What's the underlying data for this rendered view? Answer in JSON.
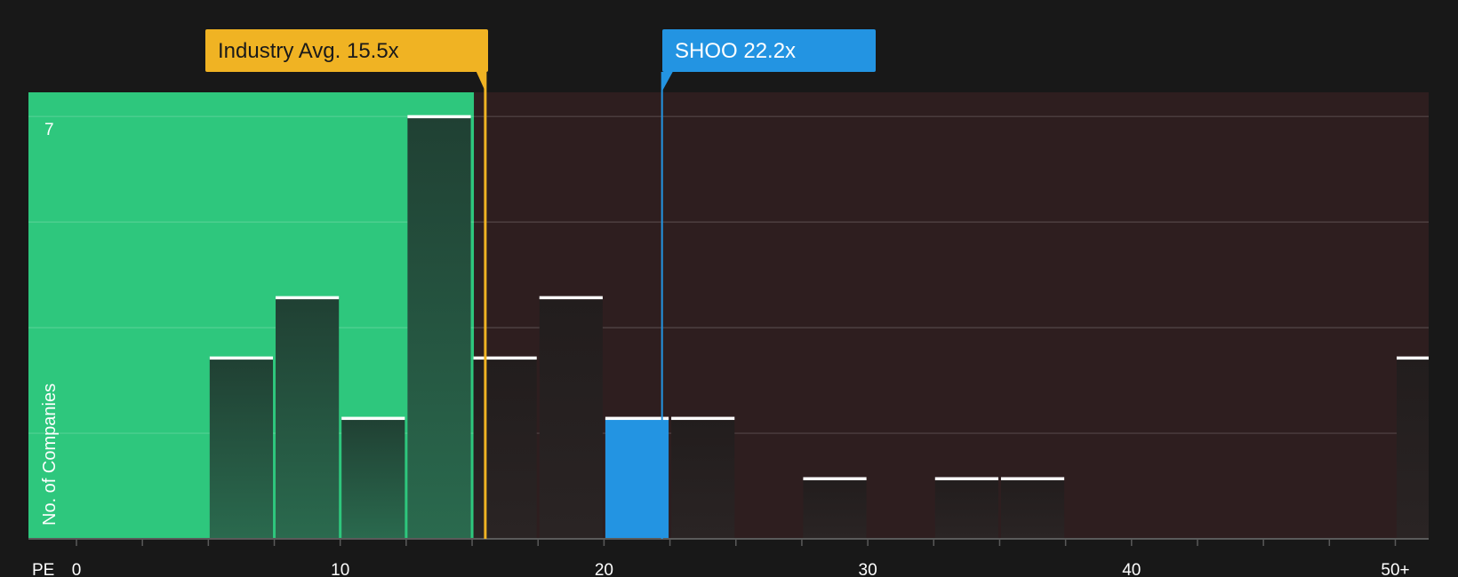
{
  "chart_data": {
    "type": "bar",
    "xlabel": "PE",
    "ylabel": "No. of Companies",
    "xlim": [
      0,
      52.5
    ],
    "ylim": [
      0,
      7.4
    ],
    "x_ticks": [
      0,
      10,
      20,
      30,
      40,
      50
    ],
    "x_tick_labels": [
      "0",
      "10",
      "20",
      "30",
      "40",
      "50+"
    ],
    "y_tick_labels": [
      {
        "value": 7,
        "label": "7"
      }
    ],
    "bin_width": 2.5,
    "bins": [
      {
        "x0": 5,
        "count": 3
      },
      {
        "x0": 7.5,
        "count": 4
      },
      {
        "x0": 10,
        "count": 2
      },
      {
        "x0": 12.5,
        "count": 7
      },
      {
        "x0": 15,
        "count": 3
      },
      {
        "x0": 17.5,
        "count": 4
      },
      {
        "x0": 20,
        "count": 2,
        "highlight": true
      },
      {
        "x0": 22.5,
        "count": 2
      },
      {
        "x0": 27.5,
        "count": 1
      },
      {
        "x0": 32.5,
        "count": 1
      },
      {
        "x0": 35,
        "count": 1
      },
      {
        "x0": 50,
        "count": 3
      }
    ],
    "markers": [
      {
        "label": "Industry Avg. 15.5x",
        "value": 15.5,
        "color": "#f0b323"
      },
      {
        "label": "SHOO 22.2x",
        "value": 22.2,
        "color": "#2394e2"
      }
    ],
    "undervalued_upto": 15,
    "colors": {
      "background": "#181818",
      "undervalued_zone": "#2ec77d",
      "overvalued_zone": "#2e1e1f",
      "bar_in_green": "#22463a",
      "bar_default": "#272222",
      "highlight": "#2394e2",
      "bar_top": "#ffffff",
      "grid": "#4a4a4a",
      "axis": "#5a5a5a",
      "text": "#ffffff"
    }
  }
}
